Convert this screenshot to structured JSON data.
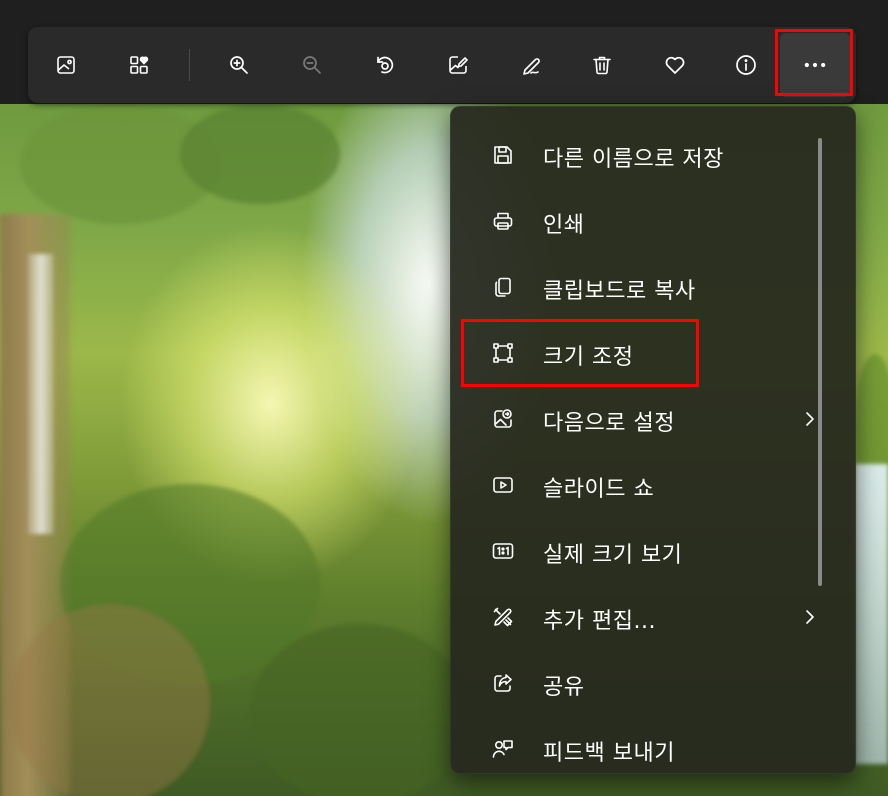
{
  "colors": {
    "highlight": "#ff0000",
    "toolbar_bg": "#2a2a2a",
    "menu_bg": "#26281e",
    "text": "#ffffff",
    "icon": "#ffffff",
    "icon_disabled": "#7a7a7a"
  },
  "toolbar": {
    "buttons": [
      {
        "icon": "gallery-icon",
        "enabled": true
      },
      {
        "icon": "collections-icon",
        "enabled": true
      },
      {
        "icon": "zoom-in-icon",
        "enabled": true
      },
      {
        "icon": "zoom-out-icon",
        "enabled": false
      },
      {
        "icon": "rotate-icon",
        "enabled": true
      },
      {
        "icon": "edit-image-icon",
        "enabled": true
      },
      {
        "icon": "draw-icon",
        "enabled": true
      },
      {
        "icon": "delete-icon",
        "enabled": true
      },
      {
        "icon": "favorite-icon",
        "enabled": true
      },
      {
        "icon": "info-icon",
        "enabled": true
      },
      {
        "icon": "more-icon",
        "enabled": true,
        "highlighted": true
      }
    ]
  },
  "menu": {
    "items": [
      {
        "label": "다른 이름으로 저장",
        "icon": "save-icon"
      },
      {
        "label": "인쇄",
        "icon": "print-icon"
      },
      {
        "label": "클립보드로 복사",
        "icon": "copy-icon"
      },
      {
        "label": "크기 조정",
        "icon": "resize-icon",
        "highlighted": true
      },
      {
        "label": "다음으로 설정",
        "icon": "set-as-icon",
        "submenu": true
      },
      {
        "label": "슬라이드 쇼",
        "icon": "slideshow-icon"
      },
      {
        "label": "실제 크기 보기",
        "icon": "actual-size-icon"
      },
      {
        "label": "추가 편집...",
        "icon": "more-edit-icon",
        "submenu": true
      },
      {
        "label": "공유",
        "icon": "share-icon"
      },
      {
        "label": "피드백 보내기",
        "icon": "feedback-icon"
      }
    ]
  }
}
